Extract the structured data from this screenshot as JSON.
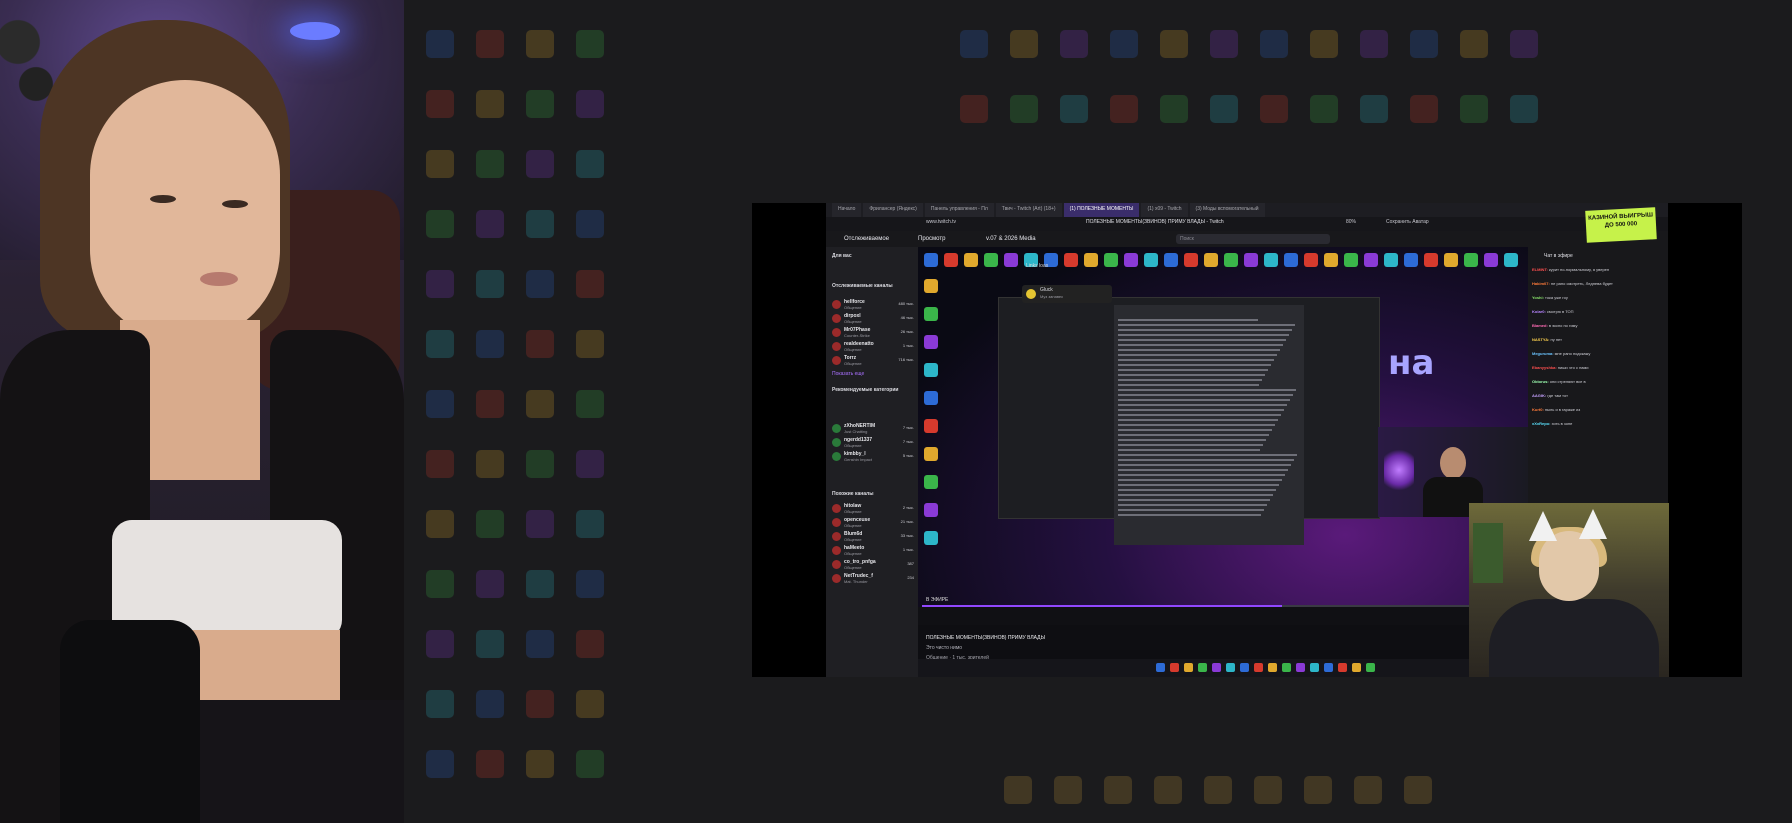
{
  "browser": {
    "tabs": [
      {
        "label": "Начало"
      },
      {
        "label": "Фрилансер (Яндекс)"
      },
      {
        "label": "Панель управления - Пл"
      },
      {
        "label": "Твич - Twitch (Art) (18+)"
      },
      {
        "label": "(1) ПОЛЕЗНЫЕ МОМЕНТЫ"
      },
      {
        "label": "(1) x09 - Twitch"
      },
      {
        "label": "(3) Моды вспомогательный"
      }
    ],
    "address": "www.twitch.tv",
    "page_title": "ПОЛЕЗНЫЕ МОМЕНТЫ(ЗВИНОВ) ПРИМУ ВЛАДЫ - Twitch",
    "zoom": "80%",
    "share_label": "Сохранить Аватар"
  },
  "twitch": {
    "nav_following": "Отслеживаемое",
    "nav_browse": "Просмотр",
    "nav_channel": "v.07 & 2026 Media",
    "search_placeholder": "Поиск",
    "promo_text": "КАЗИНОЙ ВЫИГРЫШ ДО 500 000"
  },
  "sidebar": {
    "for_you": "Для вас",
    "followed_header": "Отслеживаемые каналы",
    "followed": [
      {
        "name": "hellforce",
        "game": "Общение",
        "count": "480 тыс."
      },
      {
        "name": "dirpoxl",
        "game": "Общение",
        "count": "46 тыс."
      },
      {
        "name": "Mr07Phase",
        "game": "Counter-Strike",
        "count": "26 тыс."
      },
      {
        "name": "realdeenatto",
        "game": "Общение",
        "count": "1 тыс."
      },
      {
        "name": "Torrz",
        "game": "Общение",
        "count": "716 тыс."
      }
    ],
    "show_more": "Показать еще",
    "recommended_header": "Рекомендуемые категории",
    "recommended": [
      {
        "name": "zXhoNERTIM",
        "game": "Just Chatting",
        "count": "7 тыс."
      },
      {
        "name": "ngerdd1337",
        "game": "Общение",
        "count": "7 тыс."
      },
      {
        "name": "kimbby_l",
        "game": "Genshin Impact",
        "count": "5 тыс."
      }
    ],
    "similar_header": "Похожие каналы",
    "similar": [
      {
        "name": "hitolaw",
        "game": "Общение",
        "count": "2 тыс."
      },
      {
        "name": "openceuse",
        "game": "Общение",
        "count": "21 тыс."
      },
      {
        "name": "Blum6d",
        "game": "Общение",
        "count": "33 тыс."
      },
      {
        "name": "haMeeto",
        "game": "Общение",
        "count": "1 тыс."
      },
      {
        "name": "co_tro_pnfga",
        "game": "Общение",
        "count": "387"
      },
      {
        "name": "NetTrudec_f",
        "game": "Mat. Thunder",
        "count": "234"
      }
    ]
  },
  "stream": {
    "doc_title": "Links loas",
    "music_title": "Gluck",
    "music_artist": "Муз занавес",
    "big_text": "на",
    "live_tag": "В ЭФИРЕ",
    "title": "ПОЛЕЗНЫЕ МОМЕНТЫ(ЗВИНОВ) ПРИМУ ВЛАДЫ",
    "subtitle": "Это чисто нимо",
    "viewers": "Общение · 1 тыс. зрителей",
    "progress": 0.6
  },
  "chat": {
    "header": "Чат в эфире",
    "lines": [
      {
        "user": "ELMINT:",
        "text": "курит по-нормальному, я уверен",
        "color": "#ff4f4f"
      },
      {
        "user": "Hakim07:",
        "text": "не рано смотреть, Леднева будет",
        "color": "#ff7b3a"
      },
      {
        "user": "Yoshi:",
        "text": "тока уже гоу",
        "color": "#8ae66c"
      },
      {
        "user": "Kolar0:",
        "text": "смотрю в ТОП",
        "color": "#b785ff"
      },
      {
        "user": "Blamed:",
        "text": "в экспо по гиму",
        "color": "#ff6bb3"
      },
      {
        "user": "NASTYA:",
        "text": "ну нет",
        "color": "#ffd34f"
      },
      {
        "user": "Meguruma:",
        "text": "мне рано подскажу",
        "color": "#6bc4ff"
      },
      {
        "user": "Ebanyyshka:",
        "text": "пиши что с нами",
        "color": "#ff4f4f"
      },
      {
        "user": "Oktorus:",
        "text": "они стреляют все в",
        "color": "#9cffb0"
      },
      {
        "user": "AAGIK:",
        "text": "где там тот",
        "color": "#c6a2ff"
      },
      {
        "user": "Kurt0:",
        "text": "пыль и в гараже из",
        "color": "#ff7b3a"
      },
      {
        "user": "xXxRepo:",
        "text": "хоть в зоне",
        "color": "#5be3ff"
      }
    ]
  },
  "colors": {
    "accent": "#9147ff",
    "promo": "#c6f24a",
    "bg": "#1b1b1d"
  }
}
